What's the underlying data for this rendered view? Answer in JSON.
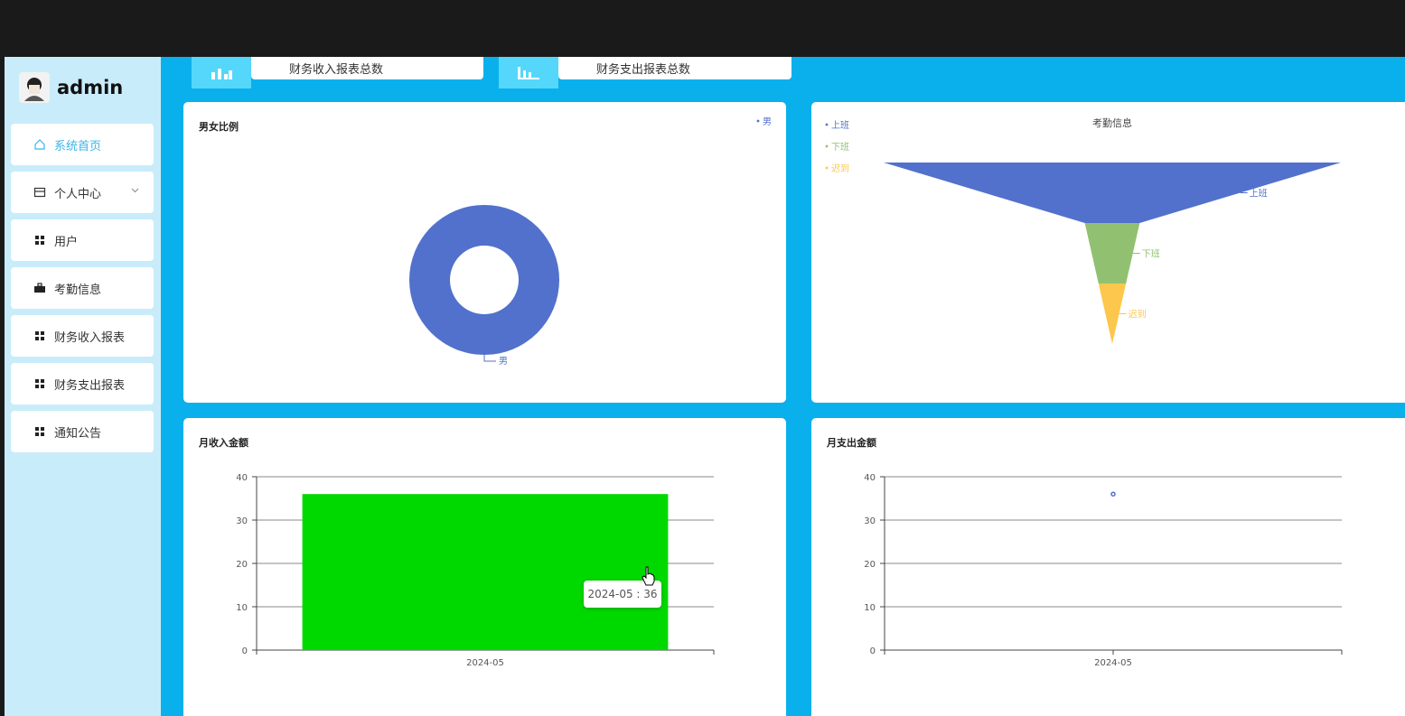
{
  "user": {
    "name": "admin"
  },
  "sidebar": {
    "items": [
      {
        "label": "系统首页",
        "icon": "home-icon",
        "active": true
      },
      {
        "label": "个人中心",
        "icon": "card-icon",
        "has_submenu": true
      },
      {
        "label": "用户",
        "icon": "grid-icon"
      },
      {
        "label": "考勤信息",
        "icon": "briefcase-icon"
      },
      {
        "label": "财务收入报表",
        "icon": "grid-icon"
      },
      {
        "label": "财务支出报表",
        "icon": "grid-icon"
      },
      {
        "label": "通知公告",
        "icon": "grid-icon"
      }
    ]
  },
  "stats": [
    {
      "title": "财务收入报表总数",
      "icon": "bar-chart-icon"
    },
    {
      "title": "财务支出报表总数",
      "icon": "column-chart-icon"
    }
  ],
  "panels": {
    "gender": {
      "title": "男女比例"
    },
    "attendance": {
      "title": "考勤信息"
    },
    "income": {
      "title": "月收入金额"
    },
    "expense": {
      "title": "月支出金额"
    }
  },
  "tooltip": {
    "text": "2024-05 : 36"
  },
  "colors": {
    "blue": "#5271cc",
    "green": "#91c170",
    "yellow": "#fcc74c",
    "bar": "#00d900",
    "accent": "#0ab0ec"
  },
  "chart_data": [
    {
      "type": "pie",
      "title": "男女比例",
      "legend": [
        "男"
      ],
      "slices": [
        {
          "name": "男",
          "value": 1
        }
      ]
    },
    {
      "type": "funnel",
      "title": "考勤信息",
      "legend": [
        "上班",
        "下班",
        "迟到"
      ],
      "stages": [
        {
          "name": "上班",
          "value": 100
        },
        {
          "name": "下班",
          "value": 12
        },
        {
          "name": "迟到",
          "value": 6
        }
      ]
    },
    {
      "type": "bar",
      "title": "月收入金额",
      "categories": [
        "2024-05"
      ],
      "values": [
        36
      ],
      "ylim": [
        0,
        40
      ],
      "yticks": [
        0,
        10,
        20,
        30,
        40
      ]
    },
    {
      "type": "scatter",
      "title": "月支出金额",
      "categories": [
        "2024-05"
      ],
      "values": [
        36
      ],
      "ylim": [
        0,
        40
      ],
      "yticks": [
        0,
        10,
        20,
        30,
        40
      ]
    }
  ]
}
